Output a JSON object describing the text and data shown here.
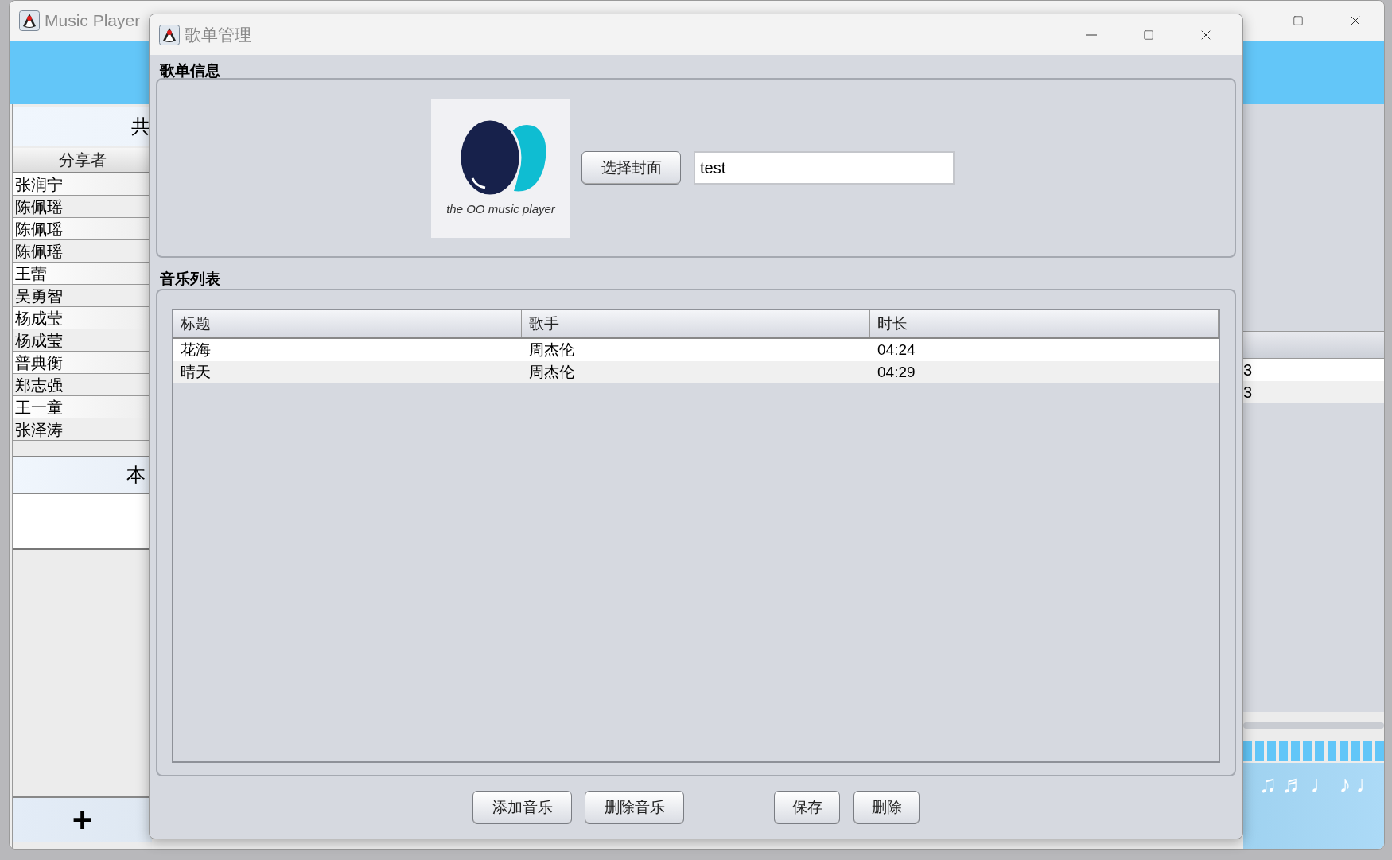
{
  "main_window": {
    "title": "Music Player",
    "shared_panel": {
      "title": "共",
      "column": "分享者",
      "rows": [
        "张润宁",
        "陈佩瑶",
        "陈佩瑶",
        "陈佩瑶",
        "王蕾",
        "吴勇智",
        "杨成莹",
        "杨成莹",
        "普典衡",
        "郑志强",
        "王一童",
        "张泽涛"
      ]
    },
    "local_panel": {
      "title": "本"
    },
    "add_button": "+",
    "table": {
      "rows": [
        {
          "column_1": "3"
        },
        {
          "column_1": "3"
        }
      ]
    },
    "notes": [
      "♫",
      "♬",
      "♩",
      "♪",
      "♩"
    ]
  },
  "dialog": {
    "title": "歌单管理",
    "info_section": {
      "label": "歌单信息",
      "cover_caption": "the OO music player",
      "cover_button": "选择封面",
      "name_field": {
        "value": "test"
      }
    },
    "music_section": {
      "label": "音乐列表",
      "columns": [
        "标题",
        "歌手",
        "时长"
      ],
      "rows": [
        {
          "title": "花海",
          "artist": "周杰伦",
          "duration": "04:24"
        },
        {
          "title": "晴天",
          "artist": "周杰伦",
          "duration": "04:29"
        }
      ]
    },
    "music_buttons": [
      "添加音乐",
      "删除音乐"
    ],
    "playlist_buttons": [
      "保存",
      "删除"
    ]
  }
}
